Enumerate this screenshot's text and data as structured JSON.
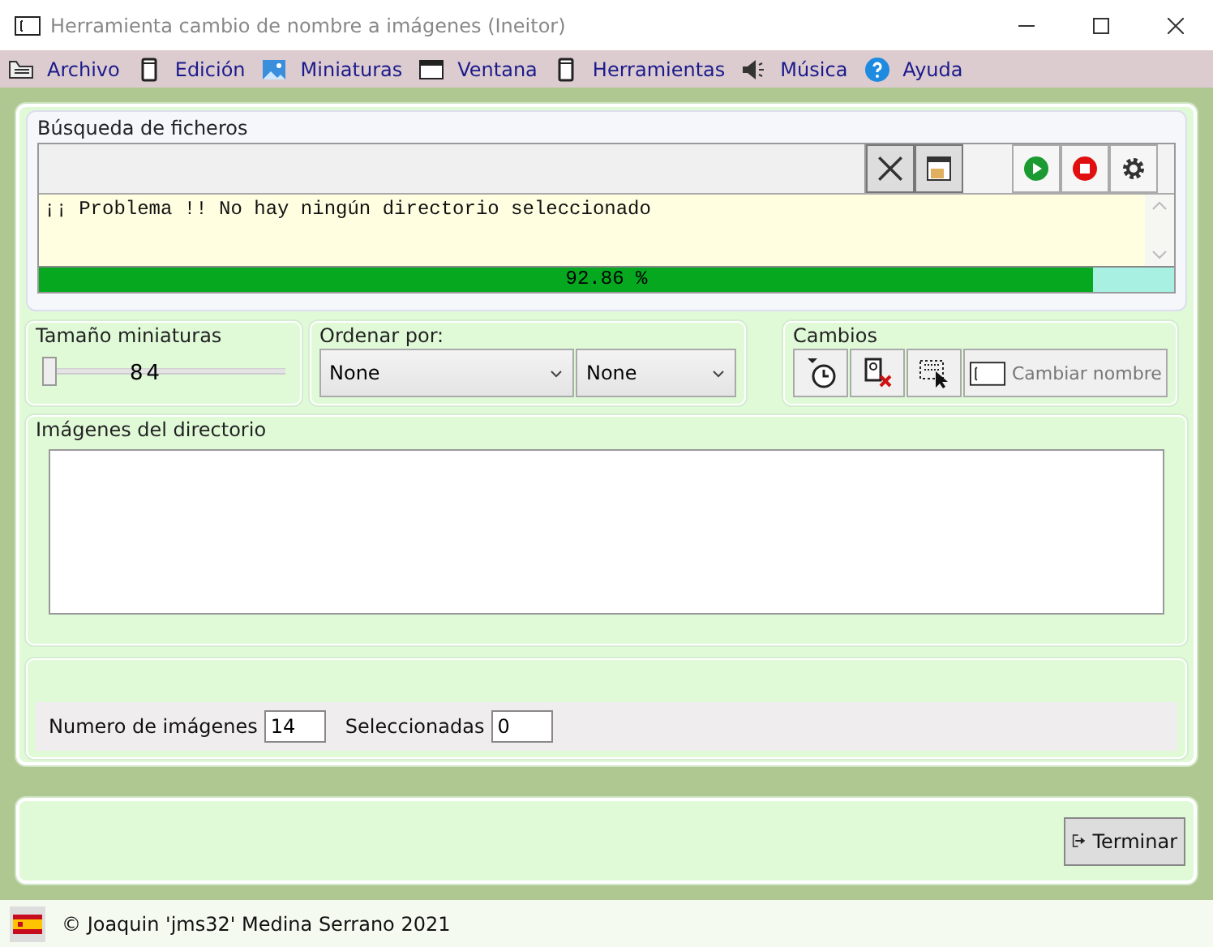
{
  "window": {
    "title": "Herramienta cambio de nombre a imágenes (Ineitor)"
  },
  "menu": [
    {
      "label": "Archivo"
    },
    {
      "label": "Edición"
    },
    {
      "label": "Miniaturas"
    },
    {
      "label": "Ventana"
    },
    {
      "label": "Herramientas"
    },
    {
      "label": "Música"
    },
    {
      "label": "Ayuda"
    }
  ],
  "search": {
    "title": "Búsqueda de ficheros",
    "message": "¡¡ Problema !! No hay ningún directorio seleccionado",
    "progress": {
      "level": 0.9286,
      "reading": "92.86 %"
    }
  },
  "thumbnail_size": {
    "title": "Tamaño miniaturas",
    "level": 0,
    "reading": "84"
  },
  "sort": {
    "title": "Ordenar por:",
    "dropdowns": [
      {
        "value": "None"
      },
      {
        "value": "None"
      }
    ]
  },
  "changes": {
    "title": "Cambios",
    "rename_button": "Cambiar nombre"
  },
  "images": {
    "title": "Imágenes del directorio"
  },
  "counts": [
    {
      "label": "Numero de imágenes",
      "value": "14"
    },
    {
      "label": "Seleccionadas",
      "value": "0"
    }
  ],
  "finish_button": "Terminar",
  "status_bar": {
    "text": "© Joaquin 'jms32' Medina Serrano 2021"
  }
}
